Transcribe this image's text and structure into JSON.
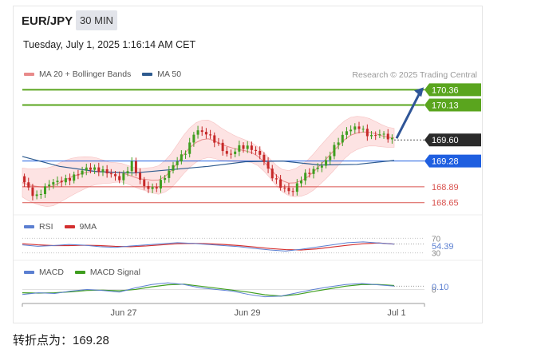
{
  "header": {
    "pair": "EUR/JPY",
    "timeframe": "30 MIN",
    "datetime": "Tuesday, July 1, 2025 1:16:14 AM CET"
  },
  "legend": {
    "main": [
      {
        "label": "MA 20 + Bollinger Bands",
        "color": "#e88a8a"
      },
      {
        "label": "MA 50",
        "color": "#2e5b8f"
      }
    ],
    "rsi": [
      {
        "label": "RSI",
        "color": "#5b7fd1"
      },
      {
        "label": "9MA",
        "color": "#d32f2f"
      }
    ],
    "macd": [
      {
        "label": "MACD",
        "color": "#5b7fd1"
      },
      {
        "label": "MACD Signal",
        "color": "#3f9e1f"
      }
    ]
  },
  "credit": "Research © 2025 Trading Central",
  "pivot_text": "转折点为：169.28",
  "chart_data": {
    "type": "line",
    "x_ticks": [
      "Jun 27",
      "Jun 29",
      "Jul 1"
    ],
    "price_range": [
      168.55,
      170.45
    ],
    "levels": [
      {
        "value": 170.36,
        "label": "170.36",
        "style": "resistance",
        "color": "#5aa51e"
      },
      {
        "value": 170.13,
        "label": "170.13",
        "style": "resistance",
        "color": "#5aa51e"
      },
      {
        "value": 169.6,
        "label": "169.60",
        "style": "last",
        "color": "#2b2b2b"
      },
      {
        "value": 169.28,
        "label": "169.28",
        "style": "pivot",
        "color": "#1f5fe0"
      },
      {
        "value": 168.89,
        "label": "168.89",
        "style": "support",
        "color": "#d9534f"
      },
      {
        "value": 168.65,
        "label": "168.65",
        "style": "support",
        "color": "#d9534f"
      }
    ],
    "price_path": [
      {
        "t": 0,
        "v": 169.05
      },
      {
        "t": 0.04,
        "v": 168.72
      },
      {
        "t": 0.08,
        "v": 168.95
      },
      {
        "t": 0.13,
        "v": 169.0
      },
      {
        "t": 0.18,
        "v": 169.18
      },
      {
        "t": 0.23,
        "v": 169.12
      },
      {
        "t": 0.27,
        "v": 169.0
      },
      {
        "t": 0.3,
        "v": 169.25
      },
      {
        "t": 0.33,
        "v": 168.9
      },
      {
        "t": 0.36,
        "v": 168.85
      },
      {
        "t": 0.39,
        "v": 169.05
      },
      {
        "t": 0.42,
        "v": 169.28
      },
      {
        "t": 0.45,
        "v": 169.45
      },
      {
        "t": 0.47,
        "v": 169.75
      },
      {
        "t": 0.5,
        "v": 169.7
      },
      {
        "t": 0.53,
        "v": 169.55
      },
      {
        "t": 0.56,
        "v": 169.35
      },
      {
        "t": 0.59,
        "v": 169.5
      },
      {
        "t": 0.62,
        "v": 169.48
      },
      {
        "t": 0.65,
        "v": 169.35
      },
      {
        "t": 0.67,
        "v": 169.1
      },
      {
        "t": 0.7,
        "v": 168.9
      },
      {
        "t": 0.73,
        "v": 168.8
      },
      {
        "t": 0.76,
        "v": 169.05
      },
      {
        "t": 0.79,
        "v": 169.15
      },
      {
        "t": 0.82,
        "v": 169.25
      },
      {
        "t": 0.85,
        "v": 169.55
      },
      {
        "t": 0.88,
        "v": 169.75
      },
      {
        "t": 0.91,
        "v": 169.8
      },
      {
        "t": 0.94,
        "v": 169.65
      },
      {
        "t": 0.97,
        "v": 169.7
      },
      {
        "t": 1.0,
        "v": 169.6
      }
    ],
    "ma50_path": [
      {
        "t": 0,
        "v": 169.35
      },
      {
        "t": 0.1,
        "v": 169.2
      },
      {
        "t": 0.2,
        "v": 169.12
      },
      {
        "t": 0.3,
        "v": 169.1
      },
      {
        "t": 0.4,
        "v": 169.15
      },
      {
        "t": 0.5,
        "v": 169.2
      },
      {
        "t": 0.6,
        "v": 169.27
      },
      {
        "t": 0.7,
        "v": 169.28
      },
      {
        "t": 0.8,
        "v": 169.22
      },
      {
        "t": 0.9,
        "v": 169.23
      },
      {
        "t": 1.0,
        "v": 169.29
      }
    ],
    "rsi": {
      "last": "54.39",
      "ticks": [
        "70",
        "30"
      ],
      "range": [
        25,
        75
      ],
      "rsi_path": [
        52,
        48,
        50,
        53,
        51,
        47,
        45,
        49,
        52,
        55,
        58,
        56,
        53,
        50,
        47,
        42,
        38,
        35,
        40,
        46,
        52,
        58,
        60,
        57,
        54
      ],
      "ma_path": [
        55,
        52,
        50,
        50,
        51,
        50,
        48,
        47,
        49,
        52,
        55,
        56,
        55,
        53,
        50,
        46,
        42,
        39,
        38,
        41,
        46,
        51,
        55,
        57,
        54
      ]
    },
    "macd": {
      "last": "0.10",
      "zero_tick": "0",
      "range": [
        -0.35,
        0.3
      ],
      "macd_path": [
        -0.15,
        -0.1,
        -0.12,
        -0.05,
        0.0,
        -0.03,
        -0.08,
        0.05,
        0.15,
        0.2,
        0.15,
        0.05,
        0.0,
        -0.05,
        -0.15,
        -0.22,
        -0.2,
        -0.1,
        0.0,
        0.08,
        0.15,
        0.18,
        0.14,
        0.1
      ],
      "signal_path": [
        -0.1,
        -0.11,
        -0.1,
        -0.07,
        -0.03,
        -0.02,
        -0.04,
        0.0,
        0.08,
        0.14,
        0.16,
        0.1,
        0.04,
        -0.02,
        -0.08,
        -0.16,
        -0.2,
        -0.15,
        -0.06,
        0.02,
        0.1,
        0.15,
        0.15,
        0.12
      ]
    }
  }
}
